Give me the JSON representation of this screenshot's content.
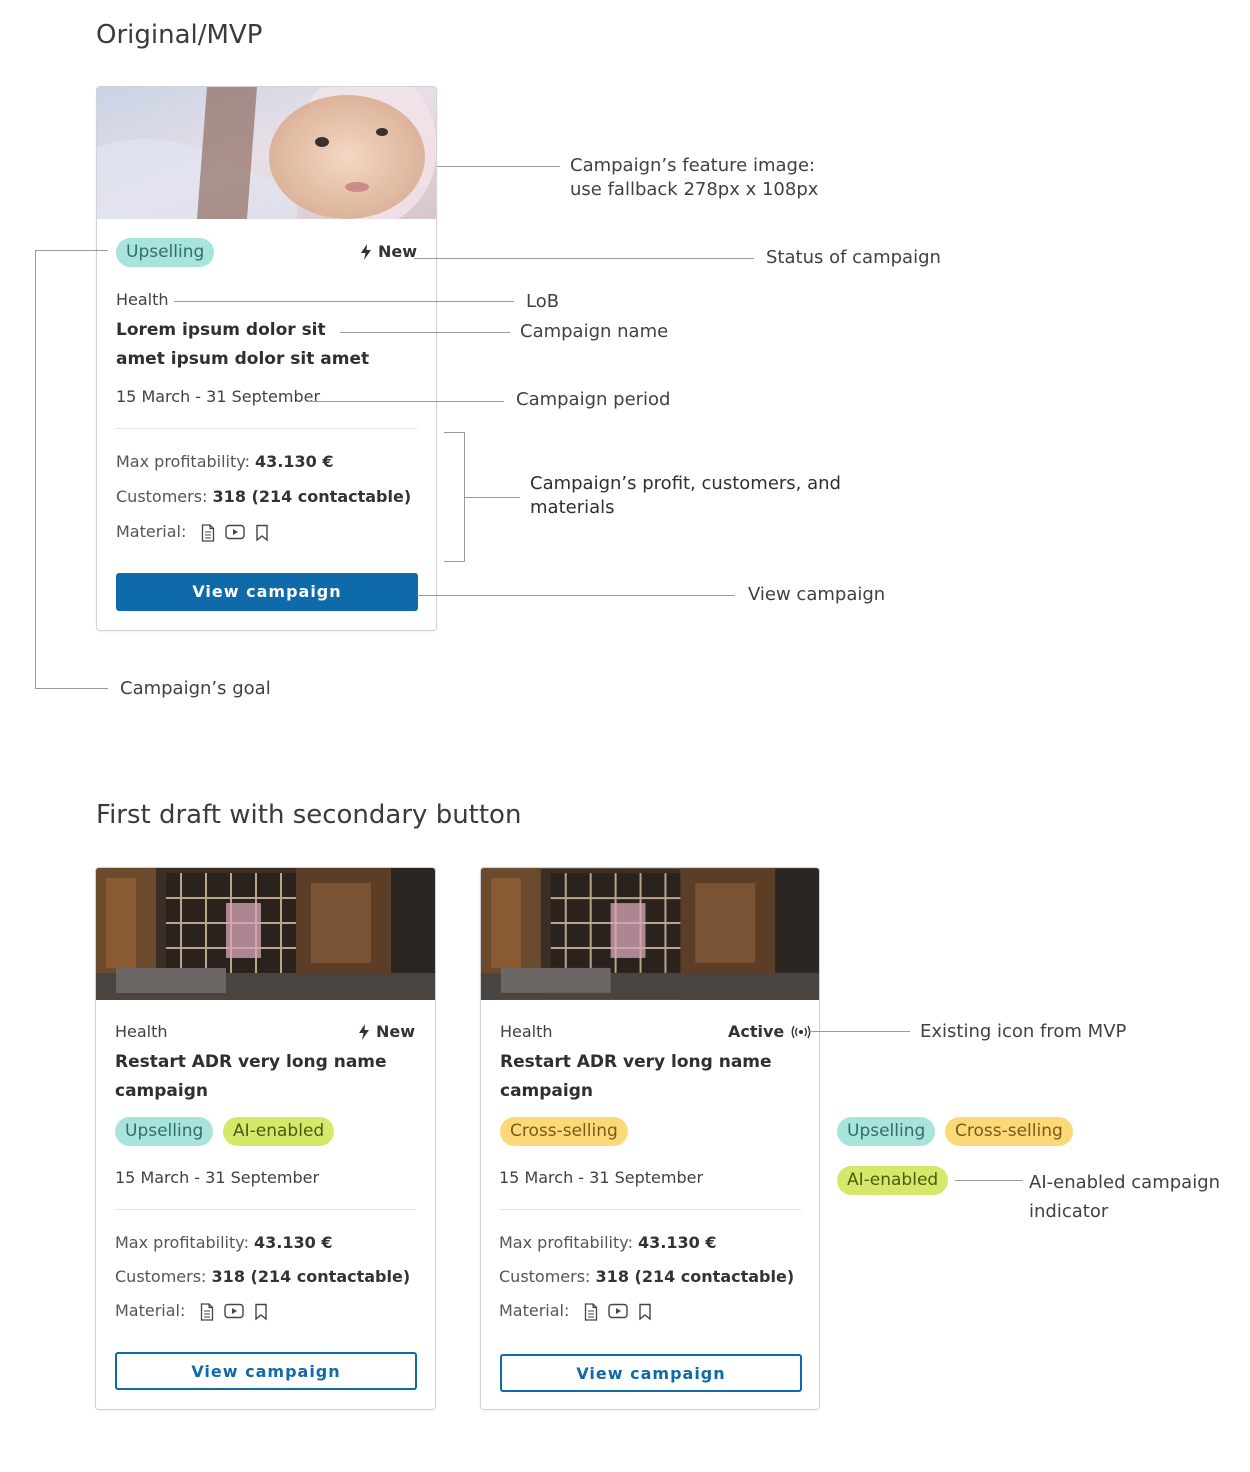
{
  "section1": {
    "title": "Original/MVP"
  },
  "section2": {
    "title": "First draft with secondary button"
  },
  "card_mvp": {
    "goal_badge": "Upselling",
    "status": "New",
    "lob": "Health",
    "name": "Lorem ipsum dolor sit amet ipsum dolor sit amet",
    "period": "15 March - 31 September",
    "profit_label": "Max profitability:",
    "profit_value": "43.130 €",
    "customers_label": "Customers:",
    "customers_value": "318 (214 contactable)",
    "material_label": "Material:",
    "button": "View campaign"
  },
  "card_draft1": {
    "lob": "Health",
    "status": "New",
    "name": "Restart ADR very long name campaign",
    "badge_1": "Upselling",
    "badge_2": "AI-enabled",
    "period": "15 March - 31 September",
    "profit_label": "Max profitability:",
    "profit_value": "43.130 €",
    "customers_label": "Customers:",
    "customers_value": "318 (214 contactable)",
    "material_label": "Material:",
    "button": "View campaign"
  },
  "card_draft2": {
    "lob": "Health",
    "status": "Active",
    "name": "Restart ADR very long name campaign",
    "badge_1": "Cross-selling",
    "period": "15 March - 31 September",
    "profit_label": "Max profitability:",
    "profit_value": "43.130 €",
    "customers_label": "Customers:",
    "customers_value": "318 (214 contactable)",
    "material_label": "Material:",
    "button": "View campaign"
  },
  "legend_badges": {
    "upselling": "Upselling",
    "cross_selling": "Cross-selling",
    "ai_enabled": "AI-enabled"
  },
  "annotations": {
    "feature_image_1": "Campaign’s feature image:",
    "feature_image_2": "use fallback 278px x 108px",
    "status": "Status of campaign",
    "lob": "LoB",
    "name": "Campaign name",
    "period": "Campaign period",
    "profit_1": "Campaign’s profit, customers, and",
    "profit_2": "materials",
    "view": "View campaign",
    "goal": "Campaign’s goal",
    "existing_icon": "Existing icon from MVP",
    "ai_1": "AI-enabled campaign",
    "ai_2": "indicator"
  },
  "colors": {
    "primary": "#0f6aa9",
    "teal_badge": "#a8e3dc",
    "yellow_badge": "#fbd979",
    "lime_badge": "#d6e86a"
  },
  "icons": {
    "status_new": "lightning-bolt-icon",
    "status_active": "broadcast-icon",
    "material": [
      "document-icon",
      "video-icon",
      "bookmark-icon"
    ]
  }
}
